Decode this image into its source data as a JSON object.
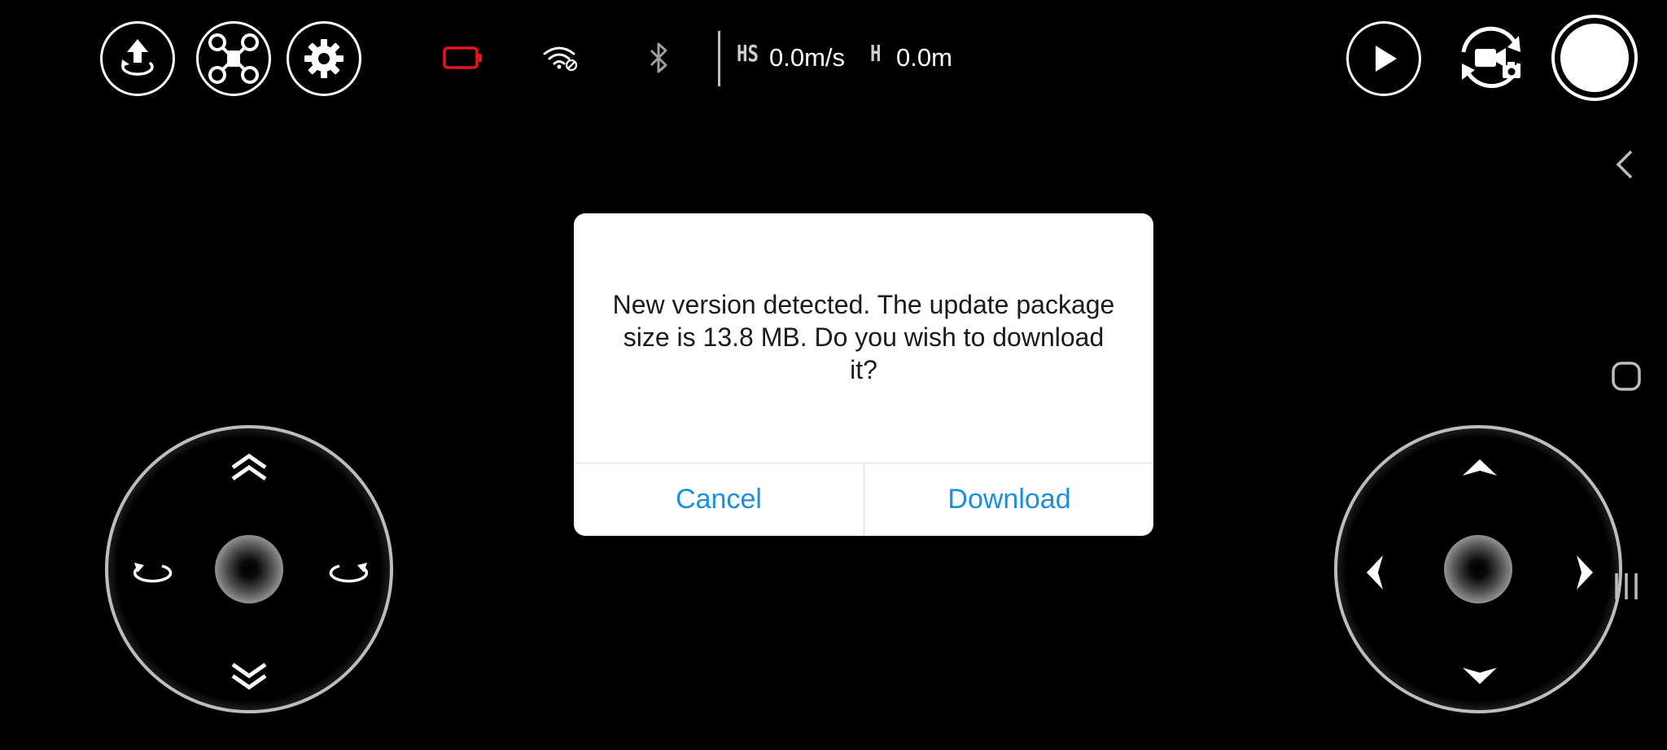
{
  "top_bar": {
    "takeoff_icon": "takeoff-icon",
    "drone_icon": "drone-icon",
    "settings_icon": "gear-icon",
    "battery_icon": "battery-icon",
    "battery_color": "#e8141c",
    "wifi_icon": "wifi-icon",
    "bluetooth_icon": "bluetooth-icon",
    "telemetry": {
      "hs_label": "HS",
      "hs_value": "0.0m/s",
      "h_label": "H",
      "h_value": "0.0m"
    },
    "playback_icon": "play-icon",
    "mode_switch_icon": "video-photo-switch-icon",
    "shutter_icon": "shutter-icon"
  },
  "dialog": {
    "message": "New version detected. The update package size is 13.8 MB. Do you wish to download it?",
    "cancel_label": "Cancel",
    "download_label": "Download",
    "accent_color": "#1a8fde"
  },
  "joysticks": {
    "left": {
      "up_icon": "ascend-icon",
      "down_icon": "descend-icon",
      "left_icon": "rotate-left-icon",
      "right_icon": "rotate-right-icon"
    },
    "right": {
      "up_icon": "forward-icon",
      "down_icon": "backward-icon",
      "left_icon": "left-icon",
      "right_icon": "right-icon"
    }
  },
  "system_nav": {
    "back_icon": "back-icon",
    "home_icon": "home-icon",
    "recents_icon": "recents-icon"
  }
}
